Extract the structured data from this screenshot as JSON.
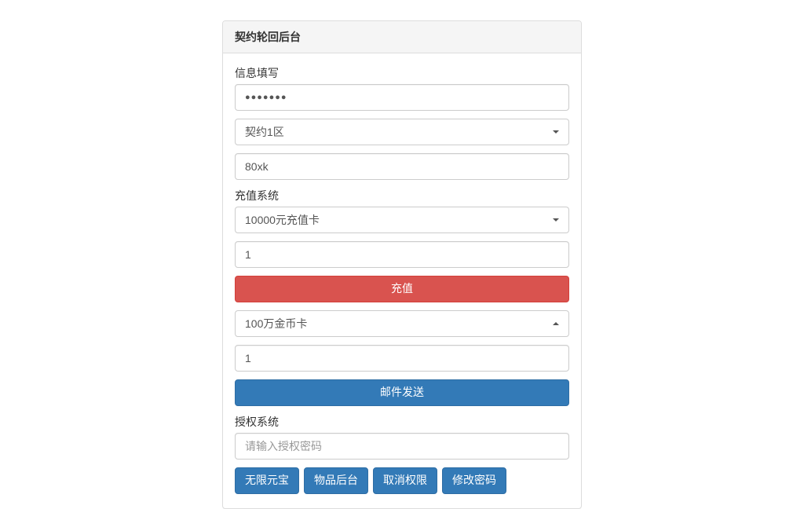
{
  "panel": {
    "title": "契约轮回后台"
  },
  "info": {
    "label": "信息填写",
    "password_value": "●●●●●●●",
    "server_select": "契约1区",
    "account_value": "80xk"
  },
  "recharge": {
    "label": "充值系统",
    "card_select": "10000元充值卡",
    "quantity_value": "1",
    "button": "充值"
  },
  "mail": {
    "item_select": "100万金币卡",
    "quantity_value": "1",
    "button": "邮件发送"
  },
  "auth": {
    "label": "授权系统",
    "password_placeholder": "请输入授权密码"
  },
  "buttons": {
    "unlimited_yuanbao": "无限元宝",
    "item_backend": "物品后台",
    "cancel_perm": "取消权限",
    "change_password": "修改密码"
  }
}
